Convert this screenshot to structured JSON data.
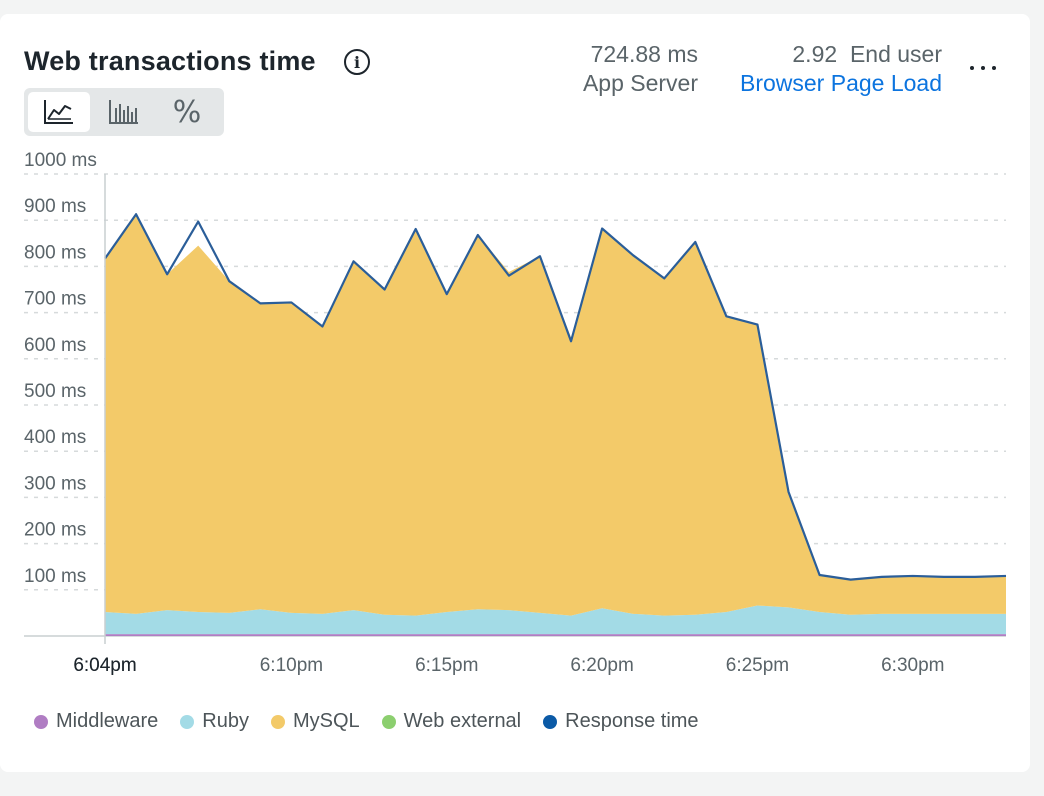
{
  "widget": {
    "title": "Web transactions time",
    "info_glyph": "i",
    "menu_icon": "more-horizontal-icon",
    "view_toggle": {
      "options": [
        {
          "name": "area-chart-icon",
          "active": true
        },
        {
          "name": "bar-chart-icon",
          "active": false
        },
        {
          "name": "percent-icon",
          "active": false
        }
      ],
      "percent_glyph": "%"
    },
    "metrics": [
      {
        "value": "724.88 ms",
        "label": "App Server"
      },
      {
        "value": "2.92",
        "unit": "End user",
        "link": "Browser Page Load"
      }
    ]
  },
  "colors": {
    "middleware": "#b07dc3",
    "ruby": "#a3dbe6",
    "mysql": "#f3ca69",
    "web_external": "#8ccf6f",
    "response_time": "#0b5aa6",
    "response_line": "#2b5e99",
    "grid": "#d6dadb",
    "axis_text": "#5a6469"
  },
  "chart_data": {
    "type": "area",
    "title": "Web transactions time",
    "stacked": true,
    "ylim": [
      0,
      1000
    ],
    "y_ticks": [
      "1000 ms",
      "900 ms",
      "800 ms",
      "700 ms",
      "600 ms",
      "500 ms",
      "400 ms",
      "300 ms",
      "200 ms",
      "100 ms"
    ],
    "y_tick_values": [
      1000,
      900,
      800,
      700,
      600,
      500,
      400,
      300,
      200,
      100
    ],
    "x_ticks": [
      "6:04pm",
      "6:10pm",
      "6:15pm",
      "6:20pm",
      "6:25pm",
      "6:30pm"
    ],
    "x_tick_minutes": [
      4,
      10,
      15,
      20,
      25,
      30
    ],
    "x_start_minute": 4,
    "x_end_minute": 33,
    "cursor_label": "6:04pm",
    "x_minutes": [
      4,
      5,
      6,
      7,
      8,
      9,
      10,
      11,
      12,
      13,
      14,
      15,
      16,
      17,
      18,
      19,
      20,
      21,
      22,
      23,
      24,
      25,
      26,
      27,
      28,
      29,
      30,
      31,
      32,
      33
    ],
    "series": [
      {
        "name": "Middleware",
        "values": [
          4,
          4,
          4,
          4,
          4,
          4,
          4,
          4,
          4,
          4,
          4,
          4,
          4,
          4,
          4,
          4,
          4,
          4,
          4,
          4,
          4,
          4,
          4,
          4,
          4,
          4,
          4,
          4,
          4,
          4
        ]
      },
      {
        "name": "Ruby",
        "values": [
          48,
          44,
          52,
          48,
          46,
          54,
          46,
          44,
          52,
          42,
          40,
          48,
          54,
          52,
          46,
          40,
          56,
          44,
          40,
          42,
          48,
          62,
          58,
          48,
          42,
          44,
          44,
          44,
          44,
          44
        ]
      },
      {
        "name": "MySQL",
        "values": [
          765,
          865,
          727,
          793,
          718,
          662,
          672,
          622,
          755,
          704,
          837,
          688,
          810,
          732,
          772,
          602,
          822,
          776,
          730,
          807,
          640,
          608,
          250,
          80,
          76,
          80,
          82,
          80,
          80,
          82
        ]
      },
      {
        "name": "Web external",
        "values": [
          0,
          0,
          0,
          0,
          0,
          0,
          0,
          0,
          0,
          0,
          0,
          0,
          0,
          0,
          0,
          0,
          0,
          0,
          0,
          0,
          0,
          0,
          0,
          0,
          0,
          0,
          0,
          0,
          0,
          0
        ]
      },
      {
        "name": "Response time",
        "values": [
          817,
          913,
          783,
          897,
          768,
          720,
          722,
          670,
          811,
          750,
          881,
          740,
          868,
          780,
          822,
          638,
          882,
          824,
          774,
          853,
          692,
          674,
          312,
          132,
          122,
          128,
          130,
          128,
          128,
          130
        ]
      }
    ],
    "legend": [
      "Middleware",
      "Ruby",
      "MySQL",
      "Web external",
      "Response time"
    ],
    "legend_position": "bottom-left",
    "grid": true
  }
}
